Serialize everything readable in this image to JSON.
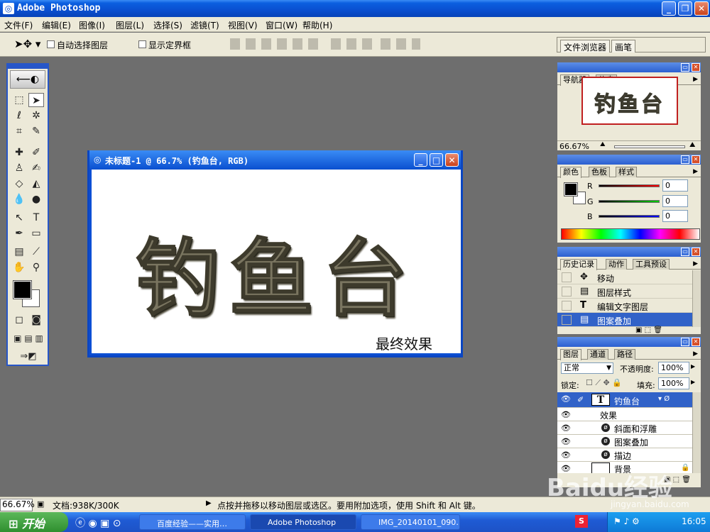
{
  "app": {
    "title": "Adobe Photoshop"
  },
  "menu": [
    "文件(F)",
    "编辑(E)",
    "图像(I)",
    "图层(L)",
    "选择(S)",
    "滤镜(T)",
    "视图(V)",
    "窗口(W)",
    "帮助(H)"
  ],
  "options": {
    "auto_select_layer": "自动选择图层",
    "show_bounding_box": "显示定界框"
  },
  "well": {
    "file_browser": "文件浏览器",
    "brushes": "画笔"
  },
  "document": {
    "title": "未标题-1 @ 66.7% (钓鱼台, RGB)",
    "text": "钓鱼台",
    "caption": "最终效果"
  },
  "navigator": {
    "tabs": [
      "导航器",
      "信息"
    ],
    "zoom": "66.67%",
    "thumb_text": "钓鱼台"
  },
  "color": {
    "tabs": [
      "颜色",
      "色板",
      "样式"
    ],
    "r_label": "R",
    "g_label": "G",
    "b_label": "B",
    "r": "0",
    "g": "0",
    "b": "0"
  },
  "history": {
    "tabs": [
      "历史记录",
      "动作",
      "工具预设"
    ],
    "items": [
      {
        "label": "移动",
        "icon": "move-icon"
      },
      {
        "label": "图层样式",
        "icon": "doc-icon"
      },
      {
        "label": "编辑文字图层",
        "icon": "text-icon"
      },
      {
        "label": "图案叠加",
        "icon": "doc-icon"
      }
    ]
  },
  "layers": {
    "tabs": [
      "图层",
      "通道",
      "路径"
    ],
    "blend_mode": "正常",
    "opacity_label": "不透明度:",
    "opacity": "100%",
    "lock_label": "锁定:",
    "fill_label": "填充:",
    "fill": "100%",
    "text_layer": "钓鱼台",
    "effects_label": "效果",
    "effects": [
      "斜面和浮雕",
      "图案叠加",
      "描边"
    ],
    "background_layer": "背景"
  },
  "status": {
    "zoom": "66.67%",
    "doc_size": "文档:938K/300K",
    "hint": "点按并拖移以移动图层或选区。要用附加选项，使用 Shift 和 Alt 键。"
  },
  "taskbar": {
    "start": "开始",
    "buttons": [
      "百度经验——实用…",
      "Adobe Photoshop",
      "IMG_20140101_090…"
    ],
    "clock": "16:05"
  },
  "watermark": {
    "logo": "Baidu经验",
    "url": "jingyan.baidu.com"
  },
  "colors": {
    "titlebar": "#0a4fd0",
    "selection": "#3162c8",
    "workspace": "#6e6e6e"
  }
}
